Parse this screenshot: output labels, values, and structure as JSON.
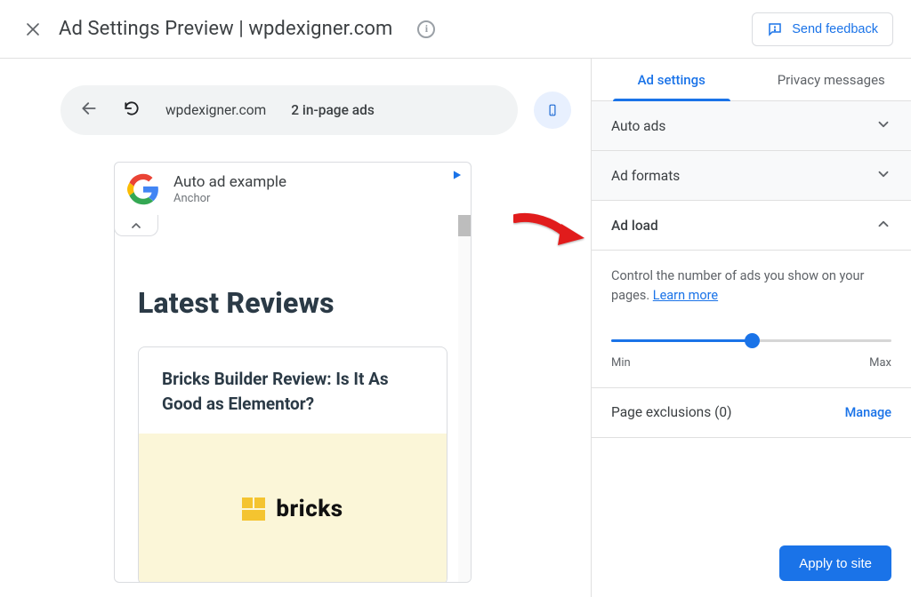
{
  "header": {
    "title": "Ad Settings Preview | wpdexigner.com",
    "feedback_label": "Send feedback"
  },
  "toolbar": {
    "url": "wpdexigner.com",
    "ads_count_label": "2 in-page ads"
  },
  "preview": {
    "ad_example_title": "Auto ad example",
    "ad_example_subtitle": "Anchor",
    "page_heading": "Latest Reviews",
    "card_title": "Bricks Builder Review: Is It As Good as Elementor?",
    "brand_text": "bricks"
  },
  "panel": {
    "tabs": {
      "settings": "Ad settings",
      "privacy": "Privacy messages"
    },
    "sections": {
      "auto_ads": "Auto ads",
      "ad_formats": "Ad formats",
      "ad_load": "Ad load",
      "page_exclusions_label": "Page exclusions (0)"
    },
    "ad_load": {
      "description": "Control the number of ads you show on your pages. ",
      "learn_more": "Learn more",
      "min_label": "Min",
      "max_label": "Max",
      "value": 50
    },
    "manage_label": "Manage",
    "apply_label": "Apply to site"
  },
  "colors": {
    "accent": "#1a73e8"
  }
}
